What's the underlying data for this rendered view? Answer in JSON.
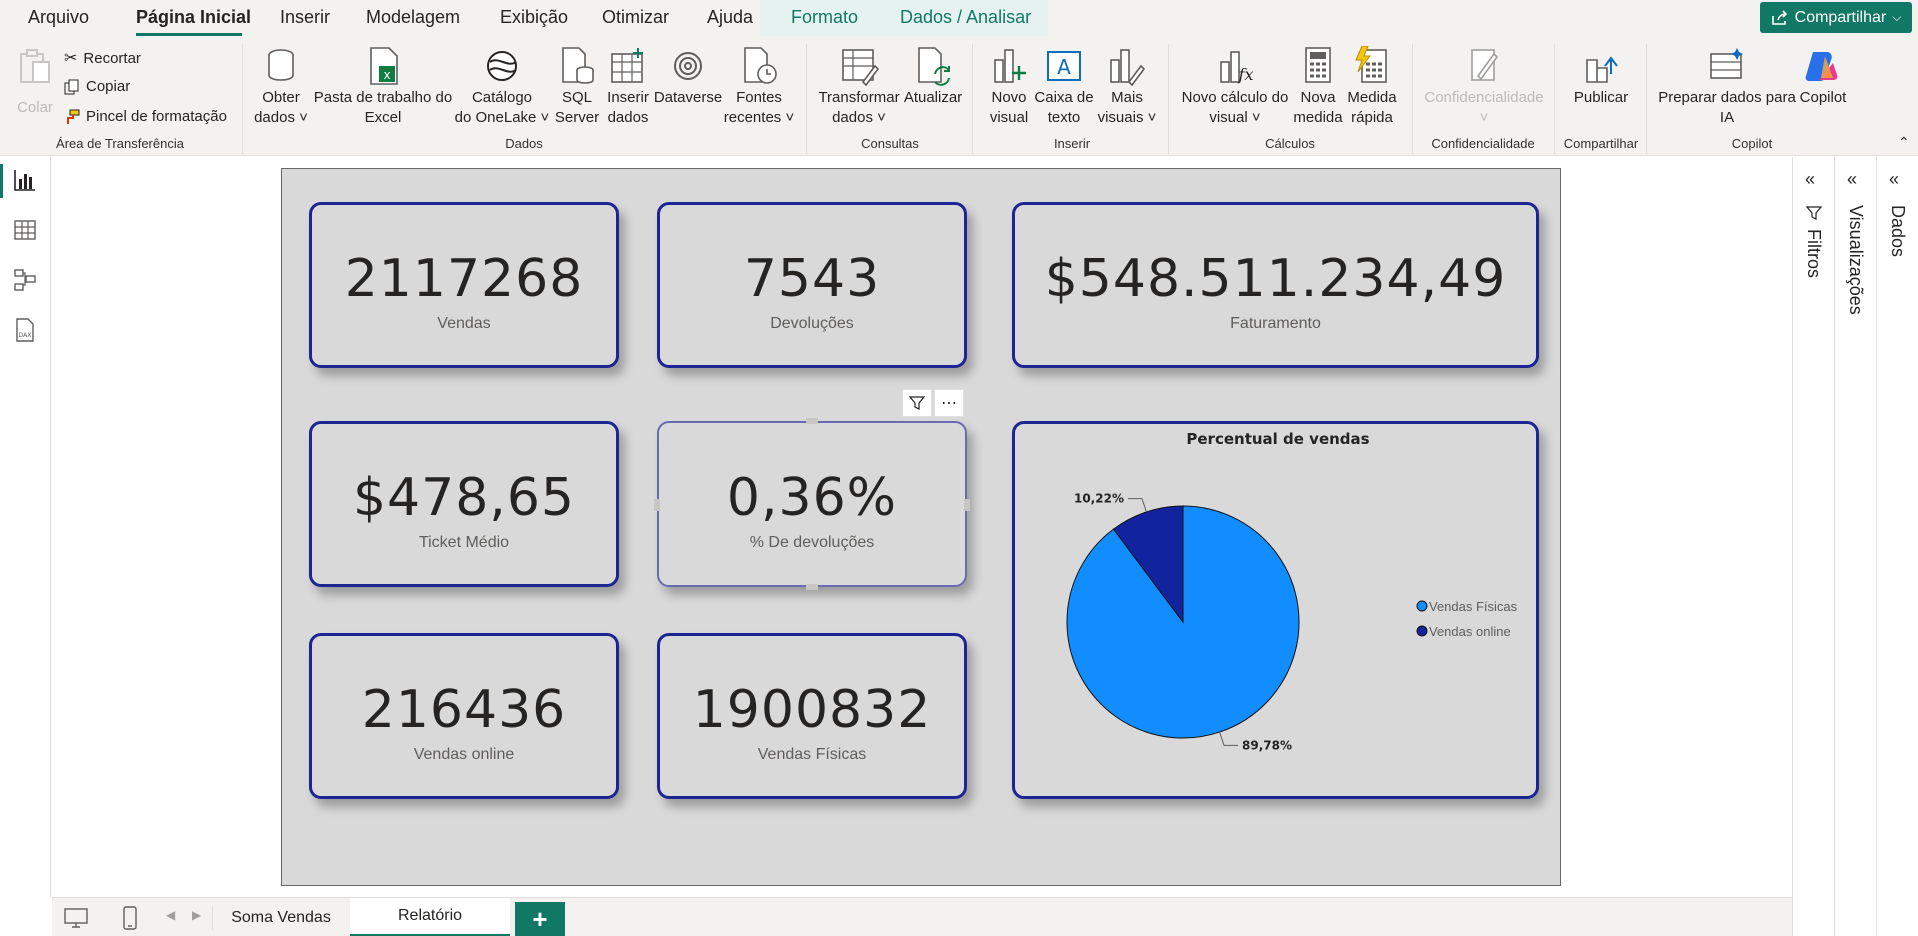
{
  "menu": {
    "items": [
      "Arquivo",
      "Página Inicial",
      "Inserir",
      "Modelagem",
      "Exibição",
      "Otimizar",
      "Ajuda",
      "Formato",
      "Dados / Analisar"
    ],
    "share": "Compartilhar"
  },
  "ribbon": {
    "clipboard": {
      "paste": "Colar",
      "cut": "Recortar",
      "copy": "Copiar",
      "format_painter": "Pincel de formatação",
      "group": "Área de Transferência"
    },
    "data": {
      "get_data": [
        "Obter",
        "dados"
      ],
      "excel": [
        "Pasta de trabalho do",
        "Excel"
      ],
      "onelake": [
        "Catálogo",
        "do OneLake"
      ],
      "sql": [
        "SQL",
        "Server"
      ],
      "enter_data": [
        "Inserir",
        "dados"
      ],
      "dataverse": "Dataverse",
      "recent": [
        "Fontes",
        "recentes"
      ],
      "group": "Dados"
    },
    "queries": {
      "transform": [
        "Transformar",
        "dados"
      ],
      "refresh": "Atualizar",
      "group": "Consultas"
    },
    "insert": {
      "new_visual": [
        "Novo",
        "visual"
      ],
      "text_box": [
        "Caixa de",
        "texto"
      ],
      "more_visuals": [
        "Mais",
        "visuais"
      ],
      "group": "Inserir"
    },
    "calc": {
      "new_visual_calc": [
        "Novo cálculo do",
        "visual"
      ],
      "new_measure": [
        "Nova",
        "medida"
      ],
      "quick_measure": [
        "Medida",
        "rápida"
      ],
      "group": "Cálculos"
    },
    "sensitivity": {
      "label": "Confidencialidade",
      "group": "Confidencialidade"
    },
    "share": {
      "publish": "Publicar",
      "group": "Compartilhar"
    },
    "copilot": {
      "prep": [
        "Preparar dados para",
        "IA"
      ],
      "copilot": "Copilot",
      "group": "Copilot"
    }
  },
  "cards": [
    {
      "value": "2117268",
      "label": "Vendas"
    },
    {
      "value": "7543",
      "label": "Devoluções"
    },
    {
      "value": "$548.511.234,49",
      "label": "Faturamento"
    },
    {
      "value": "$478,65",
      "label": "Ticket Médio"
    },
    {
      "value": "0,36%",
      "label": "% De devoluções"
    },
    {
      "value": "216436",
      "label": "Vendas online"
    },
    {
      "value": "1900832",
      "label": "Vendas Físicas"
    }
  ],
  "chart_data": {
    "type": "pie",
    "title": "Percentual de vendas",
    "categories": [
      "Vendas Físicas",
      "Vendas online"
    ],
    "values": [
      89.78,
      10.22
    ],
    "data_labels": [
      "89,78%",
      "10,22%"
    ],
    "colors": [
      "#118dff",
      "#12239e"
    ],
    "legend": "right"
  },
  "panes": {
    "filters": "Filtros",
    "visualizations": "Visualizações",
    "data": "Dados"
  },
  "tabs": [
    "Soma Vendas",
    "Relatório"
  ],
  "add_tab": "+"
}
